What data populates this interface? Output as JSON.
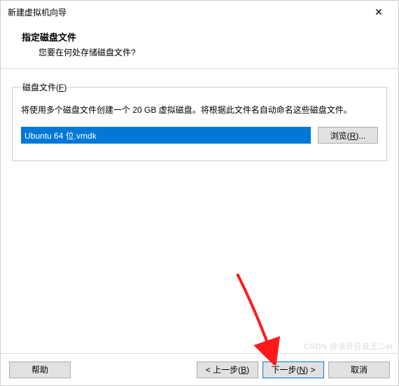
{
  "window": {
    "title": "新建虚拟机向导"
  },
  "header": {
    "title": "指定磁盘文件",
    "subtitle": "您要在何处存储磁盘文件?"
  },
  "group": {
    "legend_pre": "磁盘文件(",
    "legend_key": "F",
    "legend_post": ")",
    "description": "将使用多个磁盘文件创建一个 20 GB 虚拟磁盘。将根据此文件名自动命名这些磁盘文件。",
    "path_value": "Ubuntu 64 位.vmdk",
    "browse_pre": "浏览(",
    "browse_key": "R",
    "browse_post": ")..."
  },
  "footer": {
    "help": "帮助",
    "back_pre": "< 上一步(",
    "back_key": "B",
    "back_post": ")",
    "next_pre": "下一步(",
    "next_key": "N",
    "next_post": ") >",
    "cancel": "取消"
  },
  "watermark": "CSDN @法外狂徒王二el"
}
